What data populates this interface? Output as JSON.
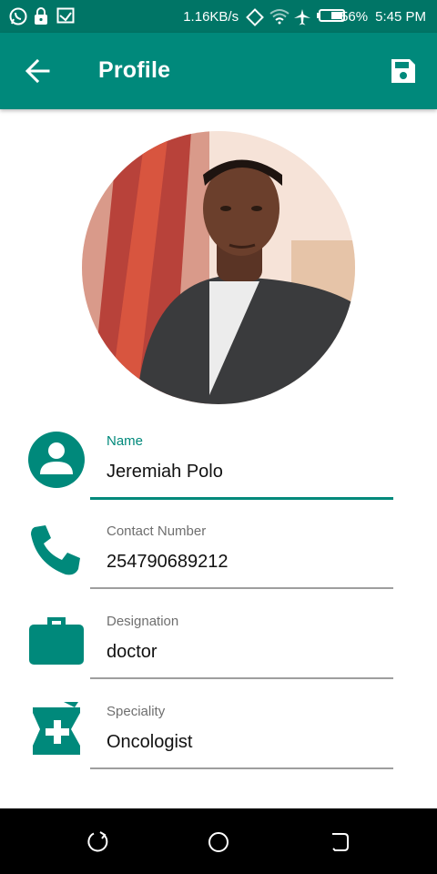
{
  "status_bar": {
    "net_speed": "1.16KB/s",
    "battery": "56%",
    "time": "5:45 PM"
  },
  "app_bar": {
    "title": "Profile"
  },
  "profile_fields": [
    {
      "label": "Name",
      "value": "Jeremiah Polo",
      "icon": "person-icon"
    },
    {
      "label": "Contact Number",
      "value": "254790689212",
      "icon": "phone-icon"
    },
    {
      "label": "Designation",
      "value": "doctor",
      "icon": "briefcase-icon"
    },
    {
      "label": "Speciality",
      "value": "Oncologist",
      "icon": "medical-bottle-icon"
    }
  ],
  "colors": {
    "accent": "#00897b",
    "status_bar": "#007566",
    "underline": "#9e9e9e",
    "nav_bar": "#000000"
  }
}
